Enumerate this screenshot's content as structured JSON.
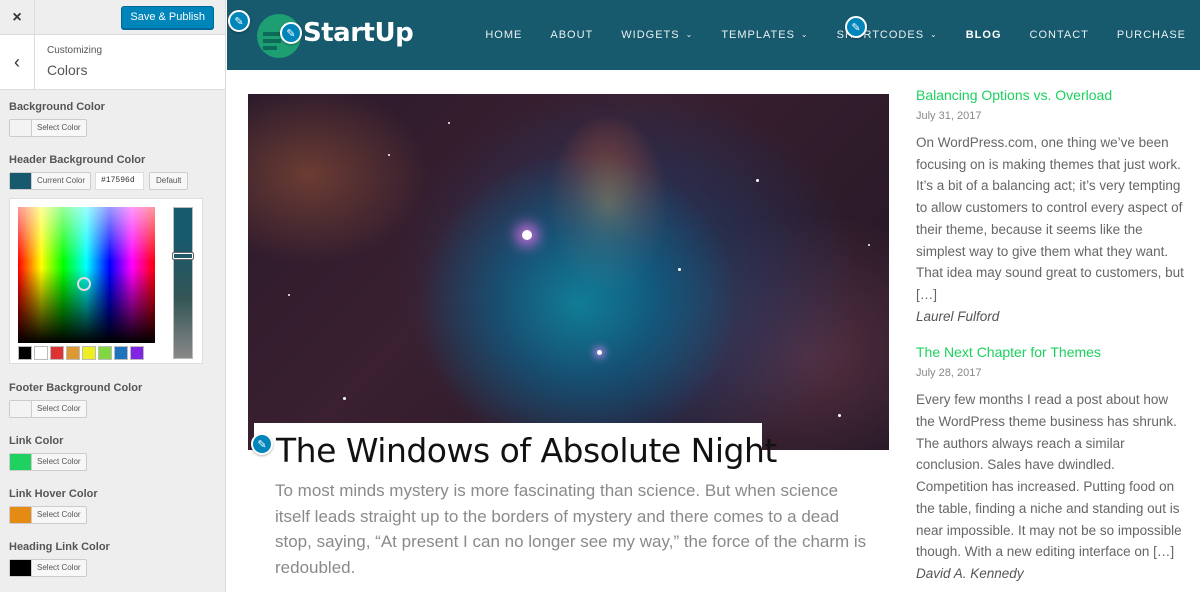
{
  "customizer": {
    "close_icon": "×",
    "publish_label": "Save & Publish",
    "back_icon": "‹",
    "breadcrumb": "Customizing",
    "section_title": "Colors",
    "controls": [
      {
        "label": "Background Color",
        "button_text": "Select Color",
        "swatch": "#f3f3f3"
      },
      {
        "label": "Header Background Color",
        "button_text": "Current Color",
        "swatch": "#17596d",
        "hex_value": "#17596d",
        "default_label": "Default"
      },
      {
        "label": "Footer Background Color",
        "button_text": "Select Color",
        "swatch": "#f3f3f3"
      },
      {
        "label": "Link Color",
        "button_text": "Select Color",
        "swatch": "#1fd15e"
      },
      {
        "label": "Link Hover Color",
        "button_text": "Select Color",
        "swatch": "#e58a12"
      },
      {
        "label": "Heading Link Color",
        "button_text": "Select Color",
        "swatch": "#000000"
      }
    ],
    "palette": [
      "#000000",
      "#ffffff",
      "#dd3333",
      "#dd9933",
      "#eeee22",
      "#81d742",
      "#1e73be",
      "#8224e3"
    ]
  },
  "site": {
    "title": "StartUp",
    "header_color": "#17596d",
    "nav": [
      {
        "label": "HOME",
        "dropdown": false,
        "active": false
      },
      {
        "label": "ABOUT",
        "dropdown": false,
        "active": false
      },
      {
        "label": "WIDGETS",
        "dropdown": true,
        "active": false
      },
      {
        "label": "TEMPLATES",
        "dropdown": true,
        "active": false
      },
      {
        "label": "SHORTCODES",
        "dropdown": true,
        "active": false
      },
      {
        "label": "BLOG",
        "dropdown": false,
        "active": true
      },
      {
        "label": "CONTACT",
        "dropdown": false,
        "active": false
      },
      {
        "label": "PURCHASE",
        "dropdown": false,
        "active": false
      }
    ],
    "featured": {
      "title": "The Windows of Absolute Night",
      "excerpt": "To most minds mystery is more fascinating than science. But when science itself leads straight up to the borders of mystery and there comes to a dead stop, saying, “At present I can no longer see my way,” the force of the charm is redoubled."
    },
    "sidebar_posts": [
      {
        "title": "Balancing Options vs. Overload",
        "date": "July 31, 2017",
        "body": "On WordPress.com, one thing we’ve been focusing on is making themes that just work. It’s a bit of a balancing act; it’s very tempting to allow customers to control every aspect of their theme, because it seems like the simplest way to give them what they want. That idea may sound great to customers, but […]",
        "author": "Laurel Fulford"
      },
      {
        "title": "The Next Chapter for Themes",
        "date": "July 28, 2017",
        "body": "Every few months I read a post about how the WordPress theme business has shrunk. The authors always reach a similar conclusion. Sales have dwindled. Competition has increased. Putting food on the table, finding a niche and standing out is near impossible. It may not be so impossible though. With a new editing interface on […]",
        "author": "David A. Kennedy"
      }
    ],
    "link_color": "#1bd15e"
  }
}
